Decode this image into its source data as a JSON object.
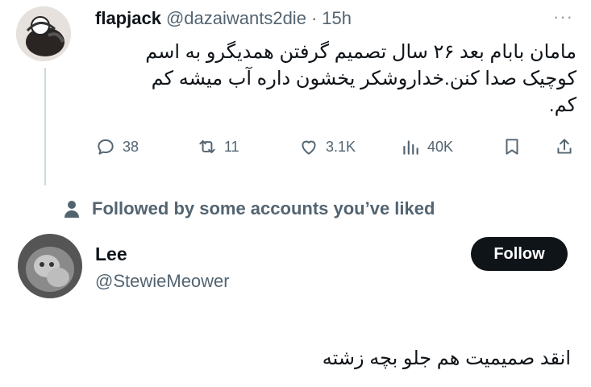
{
  "tweet": {
    "display_name": "flapjack",
    "handle": "@dazaiwants2die",
    "separator": "·",
    "time": "15h",
    "more": "···",
    "text_lines": [
      "مامان بابام بعد ۲۶ سال تصمیم گرفتن همدیگرو به اسم",
      "کوچیک صدا کنن.خداروشکر یخشون داره آب میشه کم",
      "کم."
    ],
    "stats": {
      "replies": "38",
      "reposts": "11",
      "likes": "3.1K",
      "views": "40K"
    }
  },
  "social_context": {
    "text": "Followed by some accounts you’ve liked"
  },
  "reply": {
    "display_name": "Lee",
    "handle": "@StewieMeower",
    "follow_label": "Follow",
    "text": "انقد صمیمیت هم جلو بچه زشته"
  },
  "colors": {
    "text": "#0f1419",
    "muted": "#536471",
    "button": "#0f1419"
  }
}
